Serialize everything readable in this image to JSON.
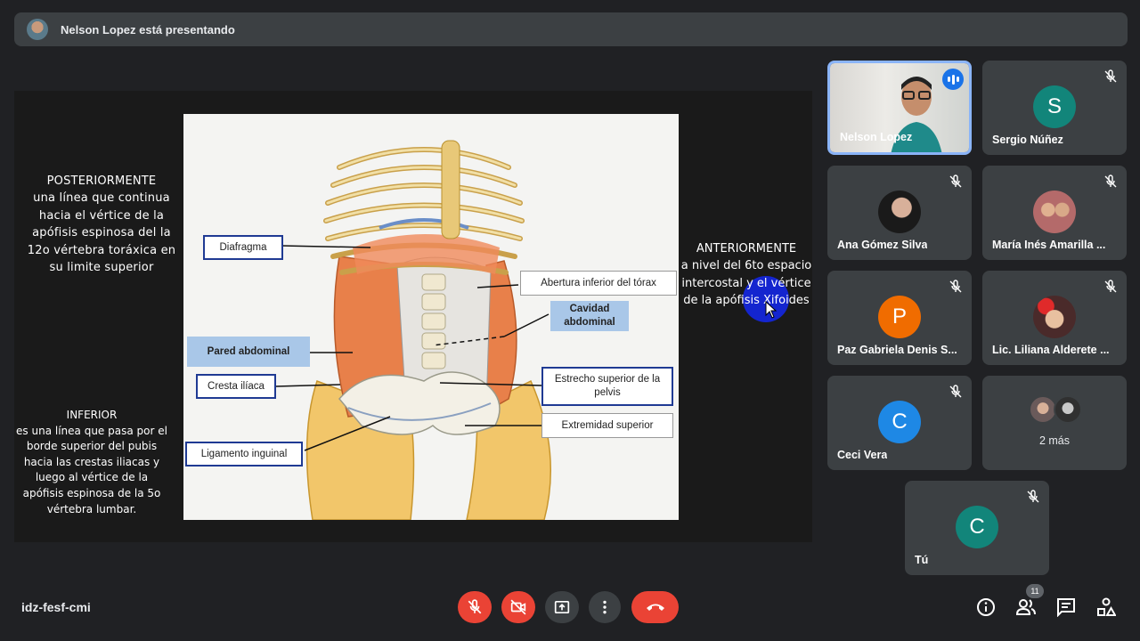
{
  "presenter_banner": "Nelson Lopez está presentando",
  "slide": {
    "posterior_title": "POSTERIORMENTE",
    "posterior_body": "una línea que continua hacia el vértice de la apófisis espinosa del la 12o vértebra toráxica en su limite superior",
    "inferior_title": "INFERIOR",
    "inferior_body": "es una línea que pasa por el borde superior del pubis hacia las crestas iliacas y luego al vértice de la apófisis espinosa de la 5o vértebra lumbar.",
    "anterior_title": "ANTERIORMENTE",
    "anterior_body": "a nivel del 6to espacio intercostal y el vértice de la apófisis Xifoides",
    "labels": {
      "diafragma": "Diafragma",
      "abertura": "Abertura inferior del tórax",
      "cavidad": "Cavidad abdominal",
      "pared": "Pared abdominal",
      "cresta": "Cresta ilíaca",
      "estrecho": "Estrecho superior de la pelvis",
      "extremidad": "Extremidad superior",
      "ligamento": "Ligamento inguinal"
    }
  },
  "participants": [
    {
      "name": "Nelson Lopez",
      "type": "video",
      "speaking": true
    },
    {
      "name": "Sergio Núñez",
      "initial": "S",
      "color": "#12857a",
      "muted": true
    },
    {
      "name": "Ana Gómez Silva",
      "type": "photo",
      "muted": true
    },
    {
      "name": "María Inés Amarilla ...",
      "type": "photo",
      "muted": true
    },
    {
      "name": "Paz Gabriela Denis S...",
      "initial": "P",
      "color": "#f06c00",
      "muted": true
    },
    {
      "name": "Lic. Liliana Alderete ...",
      "type": "photo",
      "muted": true
    },
    {
      "name": "Ceci Vera",
      "initial": "C",
      "color": "#1e88e5",
      "muted": true
    },
    {
      "more": "2 más"
    },
    {
      "name": "Tú",
      "initial": "C",
      "color": "#12857a",
      "muted": true
    }
  ],
  "meeting_code": "idz-fesf-cmi",
  "participant_count": "11",
  "icons": [
    "mic-off-icon",
    "camera-off-icon",
    "present-icon",
    "more-icon",
    "hangup-icon",
    "info-icon",
    "people-icon",
    "chat-icon",
    "activities-icon"
  ]
}
